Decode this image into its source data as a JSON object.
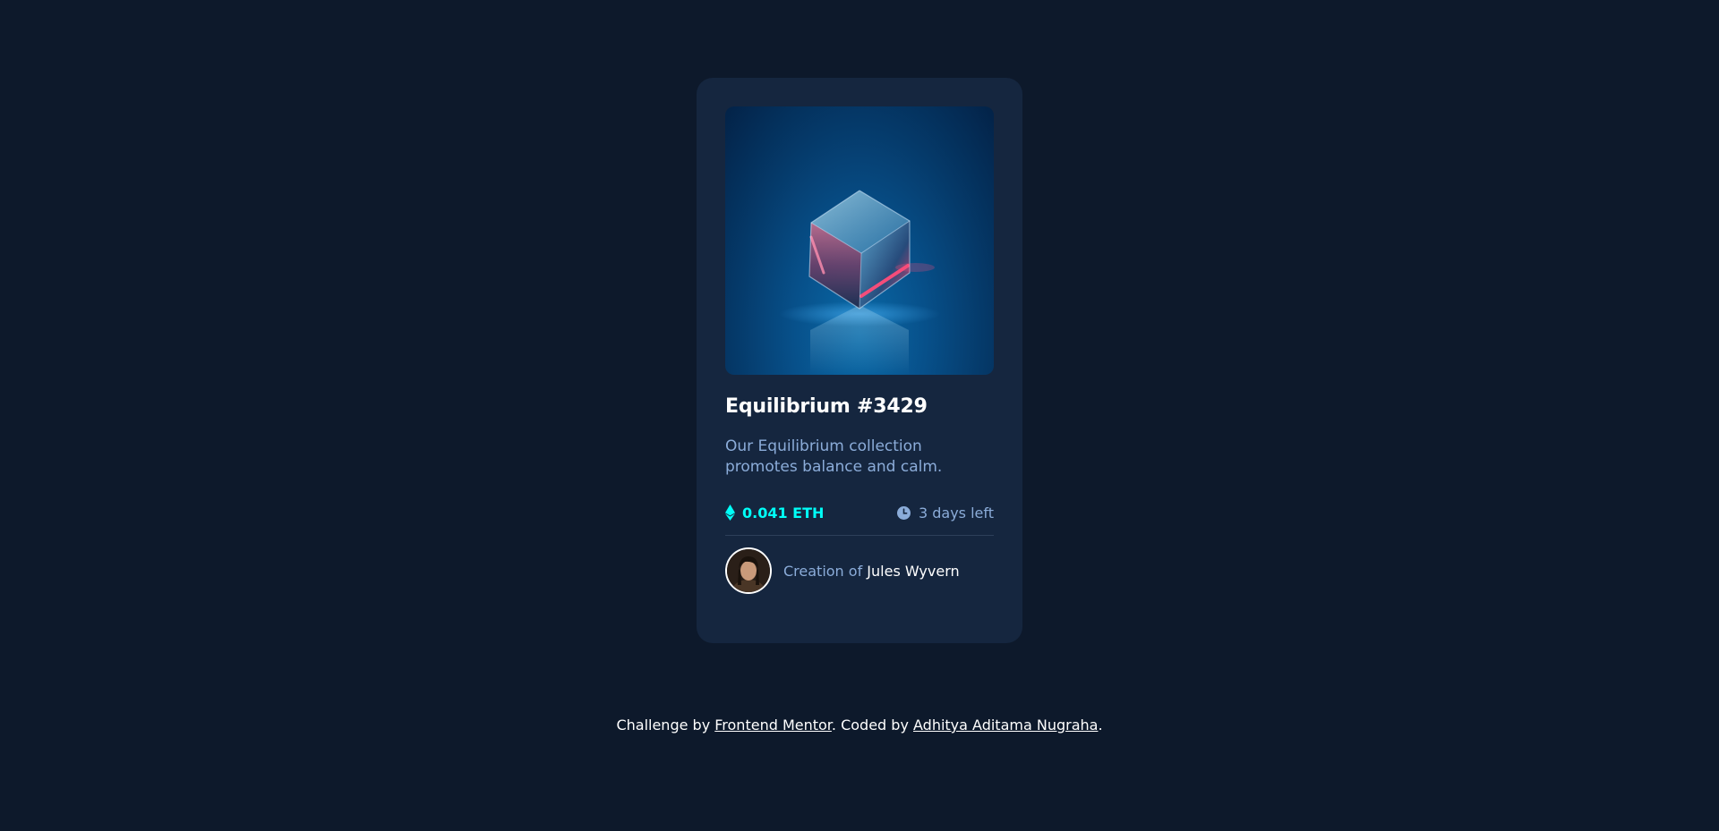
{
  "card": {
    "image_alt": "equilibrium-cube",
    "title": "Equilibrium #3429",
    "description": "Our Equilibrium collection promotes balance and calm.",
    "price": "0.041 ETH",
    "price_icon": "ethereum-icon",
    "time_left": "3 days left",
    "time_icon": "clock-icon",
    "creator_prefix": "Creation of ",
    "creator_name": "Jules Wyvern"
  },
  "footer": {
    "prefix": "Challenge by ",
    "link1": "Frontend Mentor",
    "middle": ". Coded by ",
    "link2": "Adhitya Aditama Nugraha",
    "suffix": "."
  },
  "colors": {
    "background": "#0d192b",
    "card": "#15263f",
    "cyan": "#00fff8",
    "soft_blue": "#8bacd9",
    "white": "#ffffff"
  }
}
